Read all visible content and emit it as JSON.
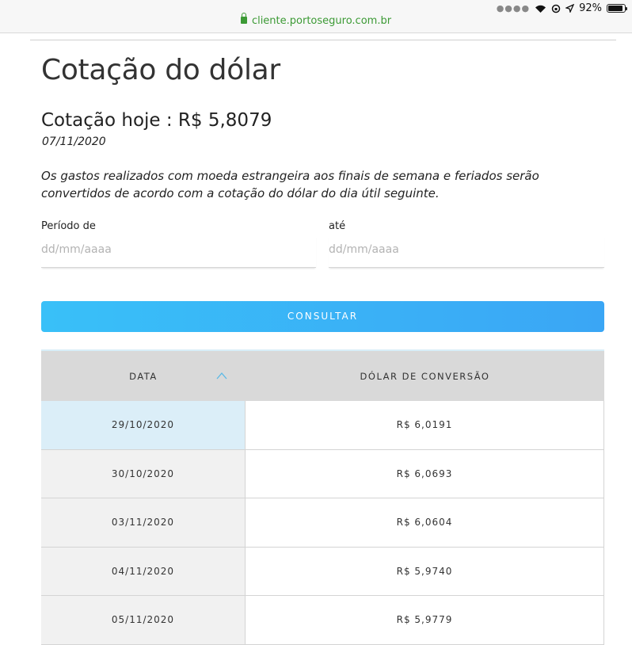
{
  "browser": {
    "url": "cliente.portoseguro.com.br",
    "battery_text": "92%"
  },
  "page": {
    "title": "Cotação do dólar",
    "today_label": "Cotação hoje : R$ 5,8079",
    "today_date": "07/11/2020",
    "notice": "Os gastos realizados com moeda estrangeira aos finais de semana e feriados serão convertidos de acordo com a cotação do dólar do dia útil seguinte."
  },
  "form": {
    "from_label": "Período de",
    "from_placeholder": "dd/mm/aaaa",
    "to_label": "até",
    "to_placeholder": "dd/mm/aaaa",
    "submit_label": "CONSULTAR"
  },
  "table": {
    "headers": [
      "DATA",
      "DÓLAR DE CONVERSÃO"
    ],
    "sort_icon": "chevron-up-icon",
    "rows": [
      {
        "date": "29/10/2020",
        "value": "R$ 6,0191"
      },
      {
        "date": "30/10/2020",
        "value": "R$ 6,0693"
      },
      {
        "date": "03/11/2020",
        "value": "R$ 6,0604"
      },
      {
        "date": "04/11/2020",
        "value": "R$ 5,9740"
      },
      {
        "date": "05/11/2020",
        "value": "R$ 5,9779"
      }
    ]
  },
  "colors": {
    "url": "#3c9a35",
    "button": "#3aa6f5",
    "selected_row": "#dbeef8",
    "header_bg": "#d9d9d9"
  }
}
